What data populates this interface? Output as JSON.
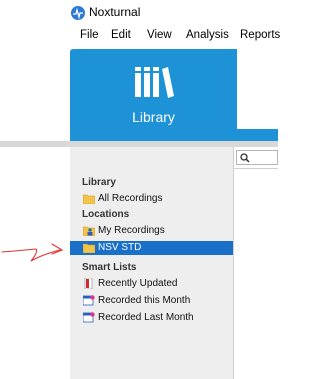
{
  "app": {
    "title": "Noxturnal"
  },
  "menu": [
    "File",
    "Edit",
    "View",
    "Analysis",
    "Reports"
  ],
  "ribbon": {
    "active_tab": "Library"
  },
  "search": {
    "placeholder": ""
  },
  "sidebar": {
    "sections": [
      {
        "title": "Library",
        "items": [
          {
            "label": "All Recordings",
            "icon": "folder-icon"
          }
        ]
      },
      {
        "title": "Locations",
        "items": [
          {
            "label": "My Recordings",
            "icon": "user-folder-icon"
          },
          {
            "label": "NSV STD",
            "icon": "folder-icon",
            "selected": true
          }
        ]
      },
      {
        "title": "Smart Lists",
        "items": [
          {
            "label": "Recently Updated",
            "icon": "smart-list-red-icon"
          },
          {
            "label": "Recorded this Month",
            "icon": "smart-list-calendar-icon"
          },
          {
            "label": "Recorded Last Month",
            "icon": "smart-list-calendar-icon"
          }
        ]
      }
    ]
  },
  "colors": {
    "accent": "#1d92d6",
    "selection": "#1a6fc9",
    "annotation_arrow": "#e53030"
  }
}
